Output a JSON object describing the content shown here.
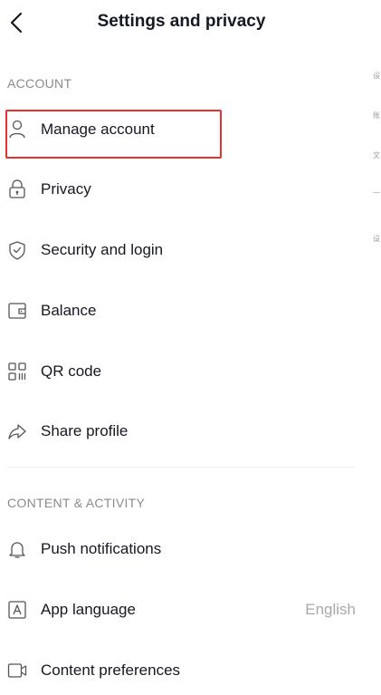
{
  "header": {
    "title": "Settings and privacy"
  },
  "sections": [
    {
      "heading": "ACCOUNT"
    },
    {
      "heading": "CONTENT & ACTIVITY"
    }
  ],
  "account_items": [
    {
      "label": "Manage account",
      "icon": "person-icon"
    },
    {
      "label": "Privacy",
      "icon": "lock-icon"
    },
    {
      "label": "Security and login",
      "icon": "shield-check-icon"
    },
    {
      "label": "Balance",
      "icon": "wallet-icon"
    },
    {
      "label": "QR code",
      "icon": "qr-code-icon"
    },
    {
      "label": "Share profile",
      "icon": "share-arrow-icon"
    }
  ],
  "content_items": [
    {
      "label": "Push notifications",
      "icon": "bell-icon"
    },
    {
      "label": "App language",
      "icon": "language-a-icon",
      "value": "English"
    },
    {
      "label": "Content preferences",
      "icon": "video-camera-icon"
    }
  ],
  "side_glyphs": [
    "设",
    "账",
    "文",
    "—",
    "设"
  ],
  "colors": {
    "highlight": "#e8312f",
    "text": "#161823",
    "muted": "#8a8b91"
  }
}
